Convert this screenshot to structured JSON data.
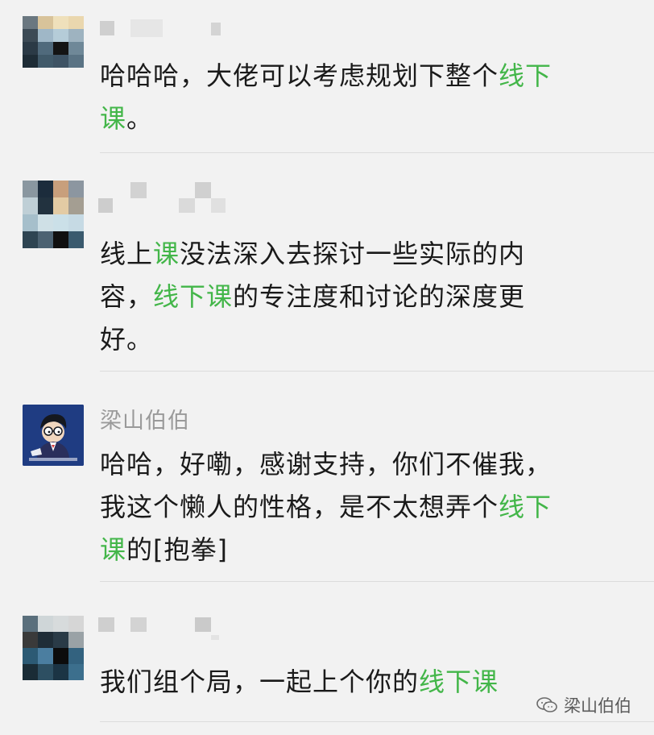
{
  "comments": [
    {
      "name": "",
      "segments": [
        {
          "t": "哈哈哈，大佬可以考虑规划下整个",
          "hl": false
        },
        {
          "t": "线下",
          "hl": true
        },
        {
          "t": "\n",
          "hl": false
        },
        {
          "t": "课",
          "hl": true
        },
        {
          "t": "。",
          "hl": false
        }
      ]
    },
    {
      "name": "",
      "segments": [
        {
          "t": "线上",
          "hl": false
        },
        {
          "t": "课",
          "hl": true
        },
        {
          "t": "没法深入去探讨一些实际的内",
          "hl": false
        },
        {
          "t": "\n",
          "hl": false
        },
        {
          "t": "容，",
          "hl": false
        },
        {
          "t": "线下课",
          "hl": true
        },
        {
          "t": "的专注度和讨论的深度更",
          "hl": false
        },
        {
          "t": "\n",
          "hl": false
        },
        {
          "t": "好。",
          "hl": false
        }
      ]
    },
    {
      "name": "梁山伯伯",
      "segments": [
        {
          "t": "哈哈，好嘞，感谢支持，你们不催我，",
          "hl": false
        },
        {
          "t": "\n",
          "hl": false
        },
        {
          "t": "我这个懒人的性格，是不太想弄个",
          "hl": false
        },
        {
          "t": "线下",
          "hl": true
        },
        {
          "t": "\n",
          "hl": false
        },
        {
          "t": "课",
          "hl": true
        },
        {
          "t": "的[抱拳]",
          "hl": false
        }
      ]
    },
    {
      "name": "",
      "segments": [
        {
          "t": "我们组个局，一起上个你的",
          "hl": false
        },
        {
          "t": "线下课",
          "hl": true
        }
      ]
    }
  ],
  "author_name": "梁山伯伯",
  "watermark": {
    "text": "梁山伯伯",
    "icon": "wechat-icon"
  },
  "colors": {
    "highlight": "#43b649",
    "background": "#f2f2f2",
    "author_avatar": "#1f3c82"
  }
}
